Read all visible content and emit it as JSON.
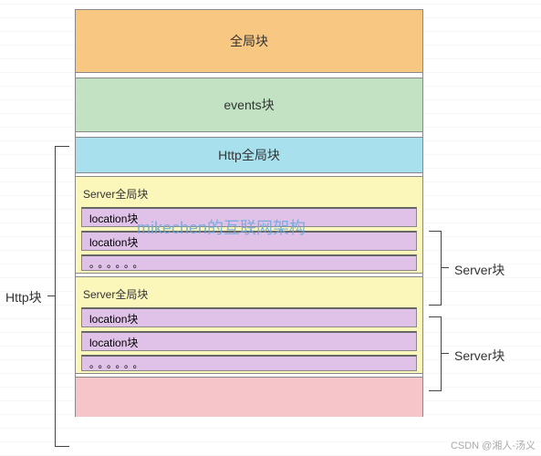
{
  "watermark": "mikechen的互联网架构",
  "attribution": "CSDN @湘人-汤义",
  "blocks": {
    "global": "全局块",
    "events": "events块",
    "http_global": "Http全局块"
  },
  "server1": {
    "title": "Server全局块",
    "loc1": "location块",
    "loc2": "location块",
    "dots": "。。。。。。"
  },
  "server2": {
    "title": "Server全局块",
    "loc1": "location块",
    "loc2": "location块",
    "dots": "。。。。。。"
  },
  "labels": {
    "http": "Http块",
    "server": "Server块"
  }
}
